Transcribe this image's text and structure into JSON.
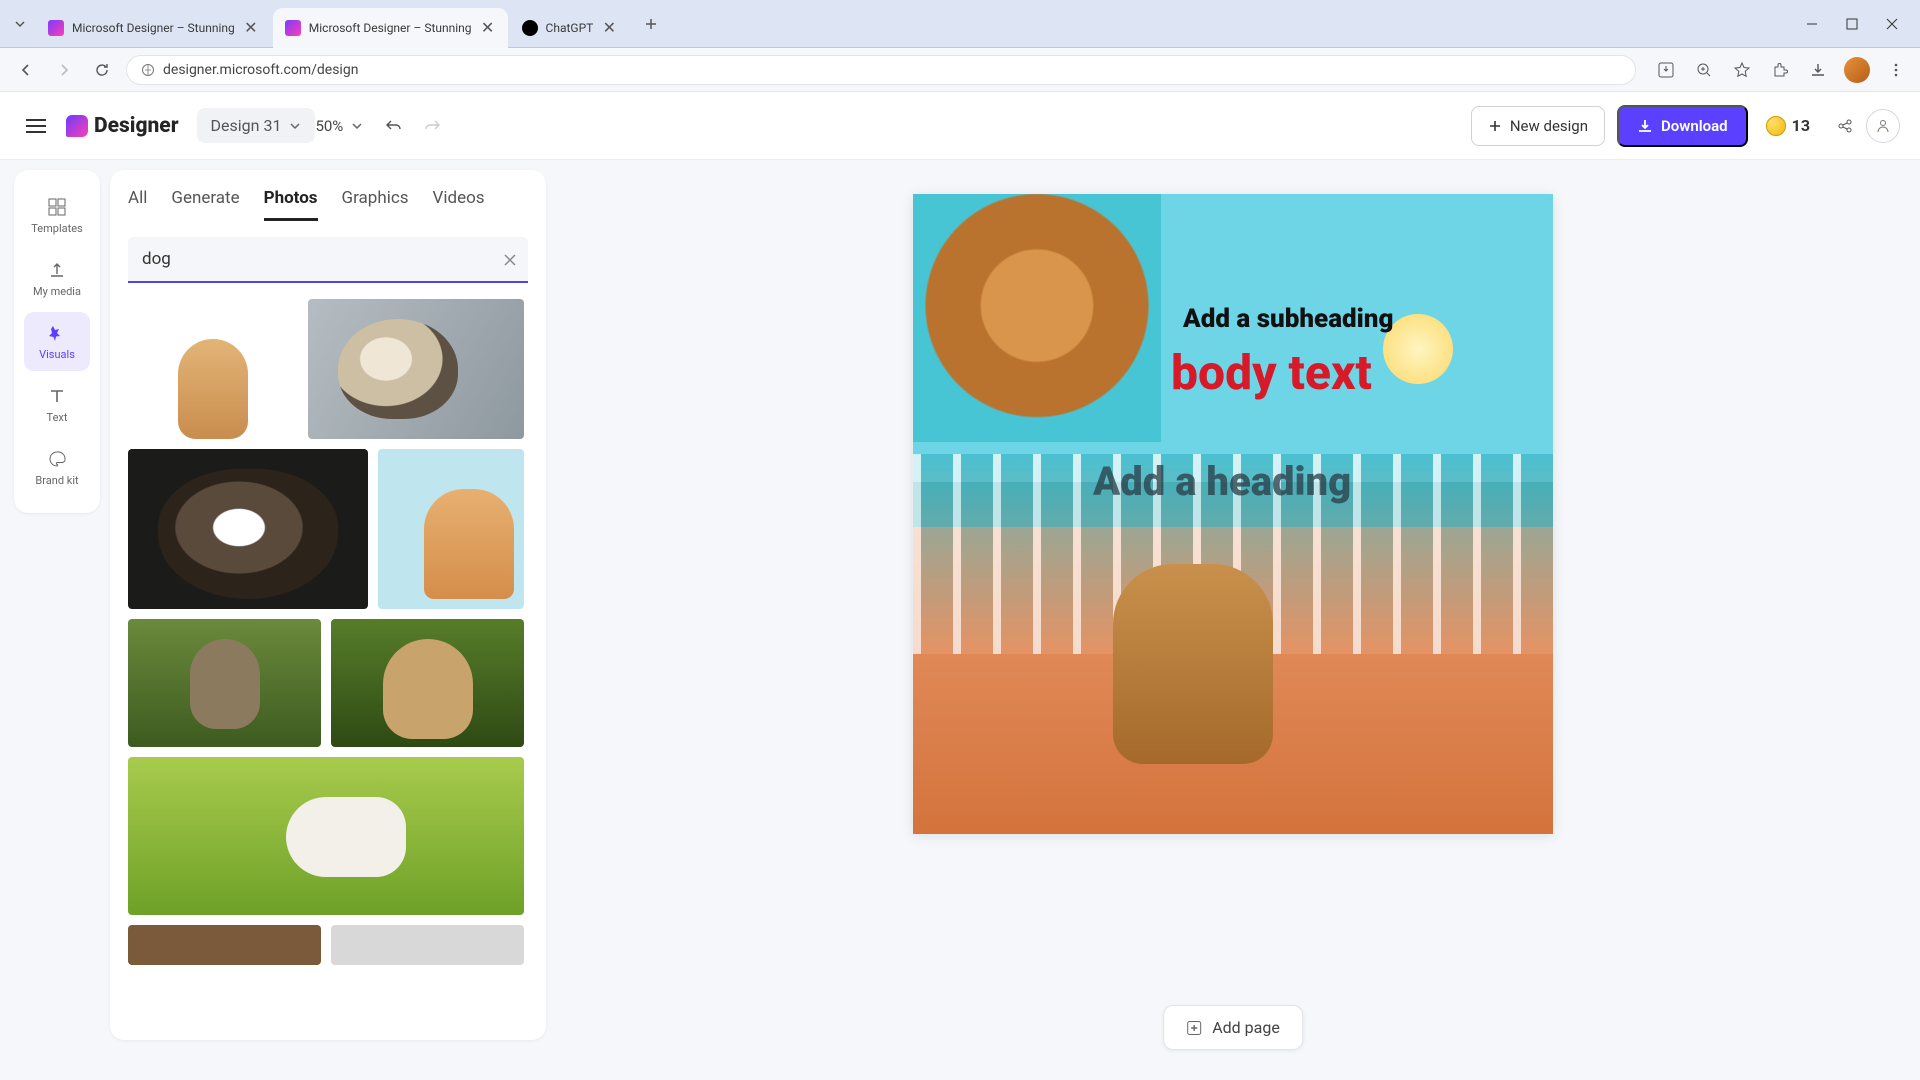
{
  "browser": {
    "tabs": [
      {
        "title": "Microsoft Designer – Stunning",
        "favicon": "#a54cff"
      },
      {
        "title": "Microsoft Designer – Stunning",
        "favicon": "#a54cff"
      },
      {
        "title": "ChatGPT",
        "favicon": "#000000"
      }
    ],
    "url": "designer.microsoft.com/design"
  },
  "app": {
    "brand": "Designer",
    "design_name": "Design 31",
    "zoom": "50%",
    "new_design_label": "New design",
    "download_label": "Download",
    "credits": "13"
  },
  "rail": {
    "items": [
      {
        "label": "Templates"
      },
      {
        "label": "My media"
      },
      {
        "label": "Visuals"
      },
      {
        "label": "Text"
      },
      {
        "label": "Brand kit"
      }
    ],
    "active_index": 2
  },
  "panel": {
    "tabs": [
      "All",
      "Generate",
      "Photos",
      "Graphics",
      "Videos"
    ],
    "active_tab_index": 2,
    "search_value": "dog"
  },
  "canvas": {
    "subheading": "Add a subheading",
    "body_text": "body text",
    "heading": "Add a heading"
  },
  "footer": {
    "add_page_label": "Add page"
  }
}
